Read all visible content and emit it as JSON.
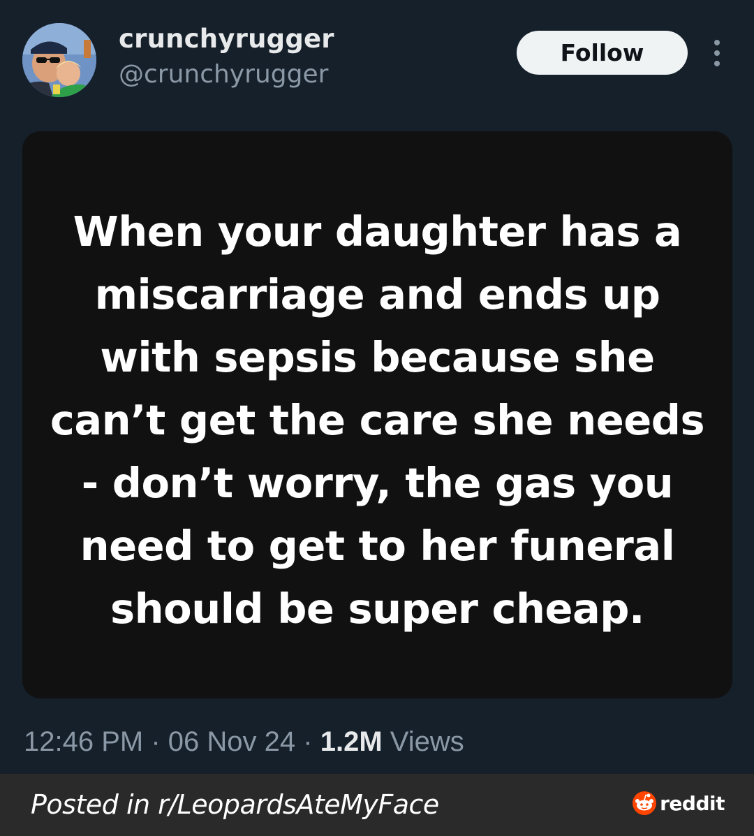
{
  "author": {
    "display_name": "crunchyrugger",
    "handle": "@crunchyrugger",
    "avatar_icon": "profile-photo"
  },
  "actions": {
    "follow_label": "Follow",
    "more_icon": "more-dots-icon"
  },
  "media": {
    "text": "When your daughter has a miscarriage and ends up with sepsis because she can’t get the care she needs - don’t worry, the gas you need to get to her funeral should be super cheap."
  },
  "meta": {
    "time": "12:46 PM",
    "separator": "·",
    "date": "06 Nov 24",
    "views_count": "1.2M",
    "views_label": "Views"
  },
  "footer": {
    "posted_in": "Posted in r/LeopardsAteMyFace",
    "brand": "reddit"
  },
  "colors": {
    "background": "#15202b",
    "card": "#111111",
    "footer": "#2a2a2a",
    "reddit_orange": "#ff4500"
  }
}
